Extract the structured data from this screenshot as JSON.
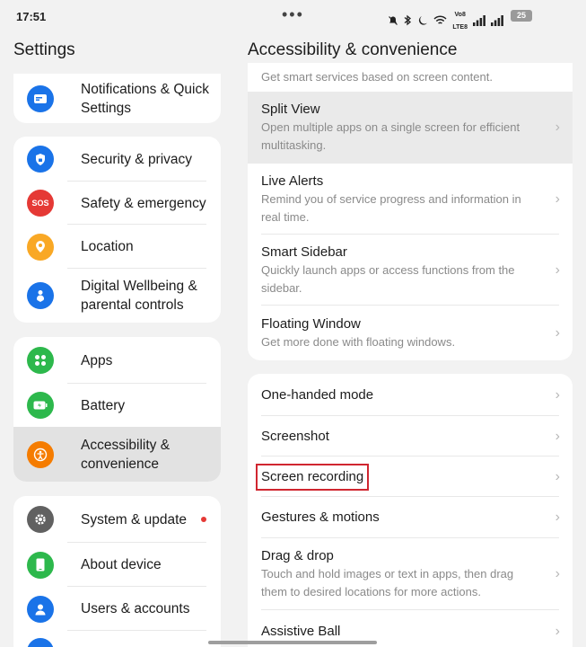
{
  "status": {
    "time": "17:51",
    "battery": "25",
    "volte_label": "Vo8\nLTE8"
  },
  "left_pane": {
    "title": "Settings",
    "groups": [
      [
        {
          "label": "Notifications & Quick Settings",
          "icon": "notifications-icon",
          "color": "#1a73e8"
        }
      ],
      [
        {
          "label": "Security & privacy",
          "icon": "lock-icon",
          "color": "#1a73e8"
        },
        {
          "label": "Safety & emergency",
          "icon": "sos-icon",
          "icon_text": "SOS",
          "color": "#e53935"
        },
        {
          "label": "Location",
          "icon": "location-pin-icon",
          "color": "#f9a825"
        },
        {
          "label": "Digital Wellbeing & parental controls",
          "icon": "wellbeing-icon",
          "color": "#1a73e8"
        }
      ],
      [
        {
          "label": "Apps",
          "icon": "apps-grid-icon",
          "color": "#2db84c"
        },
        {
          "label": "Battery",
          "icon": "battery-icon",
          "color": "#2db84c"
        },
        {
          "label": "Accessibility & convenience",
          "icon": "accessibility-icon",
          "color": "#f57c00"
        }
      ],
      [
        {
          "label": "System & update",
          "icon": "gear-icon",
          "color": "#616161"
        },
        {
          "label": "About device",
          "icon": "phone-icon",
          "color": "#2db84c"
        },
        {
          "label": "Users & accounts",
          "icon": "user-icon",
          "color": "#1a73e8"
        }
      ]
    ]
  },
  "right_pane": {
    "title": "Accessibility & convenience",
    "top_partial_subtitle": "Get smart services based on screen content.",
    "group1": [
      {
        "title": "Split View",
        "subtitle": "Open multiple apps on a single screen for efficient multitasking."
      },
      {
        "title": "Live Alerts",
        "subtitle": "Remind you of service progress and information in real time."
      },
      {
        "title": "Smart Sidebar",
        "subtitle": "Quickly launch apps or access functions from the sidebar."
      },
      {
        "title": "Floating Window",
        "subtitle": "Get more done with floating windows."
      }
    ],
    "group2": [
      {
        "title": "One-handed mode"
      },
      {
        "title": "Screenshot"
      },
      {
        "title": "Screen recording"
      },
      {
        "title": "Gestures & motions"
      },
      {
        "title": "Drag & drop",
        "subtitle": "Touch and hold images or text in apps, then drag them to desired locations for more actions."
      },
      {
        "title": "Assistive Ball"
      }
    ]
  },
  "chevron": "›"
}
